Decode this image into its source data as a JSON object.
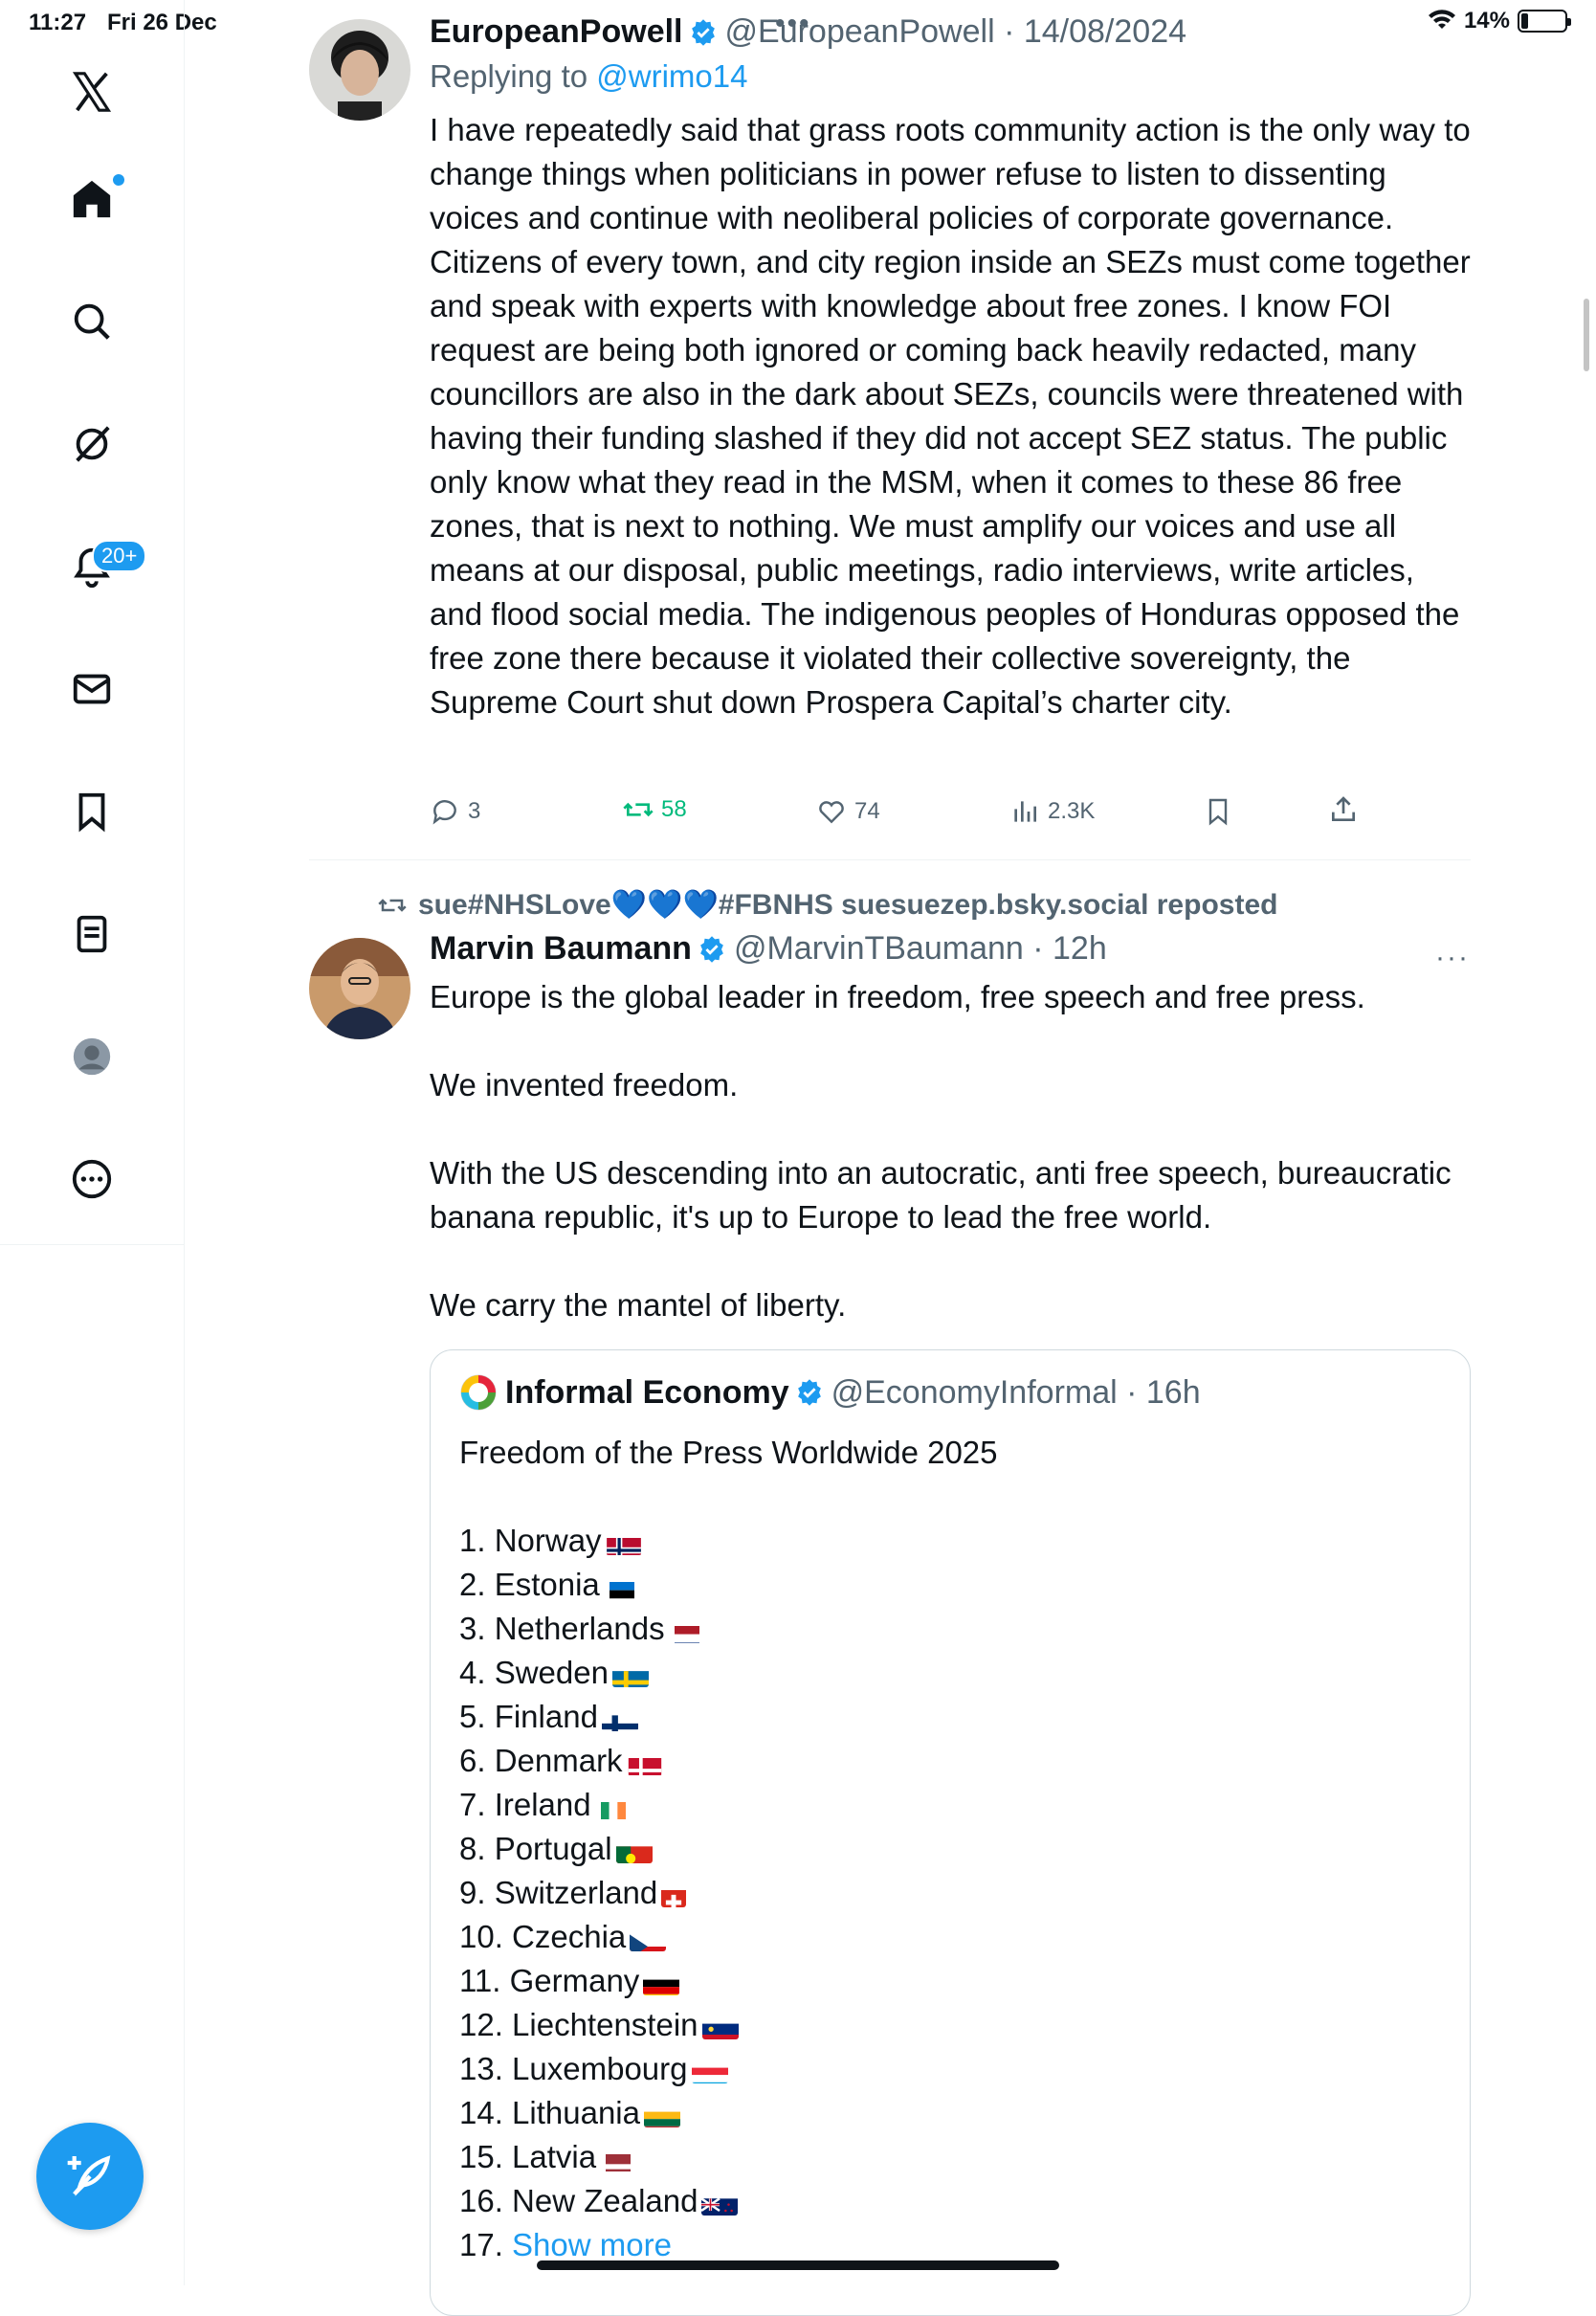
{
  "status_bar": {
    "time": "11:27",
    "date": "Fri 26 Dec",
    "battery": "14%"
  },
  "sidebar": {
    "notification_badge": "20+",
    "items": [
      {
        "icon": "x-logo-icon"
      },
      {
        "icon": "home-icon"
      },
      {
        "icon": "search-icon"
      },
      {
        "icon": "grok-icon"
      },
      {
        "icon": "bell-icon"
      },
      {
        "icon": "mail-icon"
      },
      {
        "icon": "bookmark-icon"
      },
      {
        "icon": "lists-icon"
      },
      {
        "icon": "profile-icon"
      },
      {
        "icon": "more-icon"
      }
    ],
    "compose_icon": "compose-icon"
  },
  "tweet1": {
    "name": "EuropeanPowell",
    "handle": "@EuropeanPowell · 14/08/2024",
    "replying_prefix": "Replying to ",
    "replying_to": "@wrimo14",
    "text": "I have repeatedly said that grass roots community action is the only way to change things when politicians in power refuse to listen to dissenting voices and continue with neoliberal policies of corporate governance. Citizens of every town, and city region inside an SEZs must come together and speak with experts with knowledge about free zones. I know FOI request are being both ignored or coming back heavily redacted, many councillors are also in the dark about SEZs, councils were threatened with having their funding slashed if they did not accept SEZ status. The public only know what they read in the MSM, when it comes to these 86 free zones, that is next to nothing. We must amplify our voices and use all means at our disposal, public meetings, radio interviews, write articles, and flood social media. The indigenous peoples of Honduras opposed the free zone there because it violated their collective sovereignty, the Supreme Court shut down Prospera Capital’s charter city.",
    "replies": "3",
    "reposts": "58",
    "likes": "74",
    "views": "2.3K",
    "repost_color": "#00ba7c"
  },
  "tweet2": {
    "reposted_by": "sue#NHSLove💙💙💙#FBNHS suesuezep.bsky.social reposted",
    "name": "Marvin Baumann",
    "handle": "@MarvinTBaumann · 12h",
    "text": "Europe is the global leader in freedom, free speech and free press.\n\nWe invented freedom.\n\nWith the US descending into an autocratic, anti free speech, bureaucratic banana republic, it's up to Europe to lead the free world.\n\nWe carry the mantel of liberty.",
    "more": "···"
  },
  "quote": {
    "name": "Informal Economy",
    "handle": "@EconomyInformal · 16h",
    "title": "Freedom of the Press Worldwide 2025",
    "items": [
      "1. Norway",
      "2. Estonia",
      "3. Netherlands",
      "4. Sweden",
      "5. Finland",
      "6. Denmark",
      "7. Ireland",
      "8. Portugal",
      "9. Switzerland",
      "10. Czechia",
      "11. Germany",
      "12. Liechtenstein",
      "13. Luxembourg",
      "14. Lithuania",
      "15. Latvia",
      "16. New Zealand"
    ],
    "last_prefix": "17. ",
    "show_more": "Show more"
  },
  "colors": {
    "accent": "#1d9bf0",
    "text": "#0f1419",
    "muted": "#536471"
  }
}
